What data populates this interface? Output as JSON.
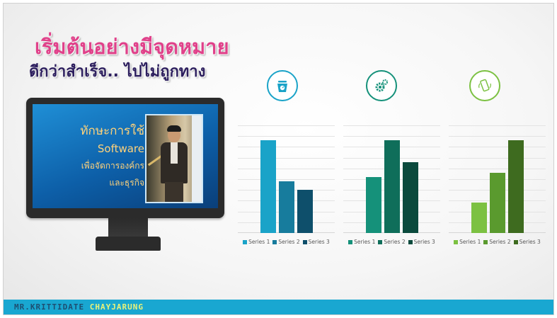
{
  "slide": {
    "title_line1": "เริ่มต้นอย่างมีจุดหมาย",
    "title_line2": "ดีกว่าสำเร็จ.. ไปไม่ถูกทาง"
  },
  "monitor": {
    "screen_text": [
      "ทักษะการใช้",
      "Software",
      "เพื่อจัดการองค์กร",
      "และธุรกิจ"
    ]
  },
  "icons": [
    {
      "name": "scale-icon",
      "color": "#1aa3c8"
    },
    {
      "name": "gears-icon",
      "color": "#15917a"
    },
    {
      "name": "phone-icon",
      "color": "#7cc142"
    }
  ],
  "footer": {
    "first_name": "MR.KRITTIDATE",
    "last_name": "CHAYJARUNG",
    "color": "#19a7d1"
  },
  "chart_data": [
    {
      "type": "bar",
      "categories": [
        "Series 1",
        "Series 2",
        "Series 3"
      ],
      "values": [
        4.3,
        2.4,
        2.0
      ],
      "ylim": [
        0,
        5
      ],
      "grid": true,
      "legend": [
        "Series 1",
        "Series 2",
        "Series 3"
      ],
      "legend_position": "bottom",
      "colors": [
        "#1aa3c8",
        "#177c9d",
        "#0e4f6b"
      ]
    },
    {
      "type": "bar",
      "categories": [
        "Series 1",
        "Series 2",
        "Series 3"
      ],
      "values": [
        2.6,
        4.3,
        3.3
      ],
      "ylim": [
        0,
        5
      ],
      "grid": true,
      "legend": [
        "Series 1",
        "Series 2",
        "Series 3"
      ],
      "legend_position": "bottom",
      "colors": [
        "#15917a",
        "#0f6e5a",
        "#0b4a3d"
      ]
    },
    {
      "type": "bar",
      "categories": [
        "Series 1",
        "Series 2",
        "Series 3"
      ],
      "values": [
        1.4,
        2.8,
        4.3
      ],
      "ylim": [
        0,
        5
      ],
      "grid": true,
      "legend": [
        "Series 1",
        "Series 2",
        "Series 3"
      ],
      "legend_position": "bottom",
      "colors": [
        "#7cc142",
        "#5a9a2e",
        "#3e6b1f"
      ]
    }
  ]
}
